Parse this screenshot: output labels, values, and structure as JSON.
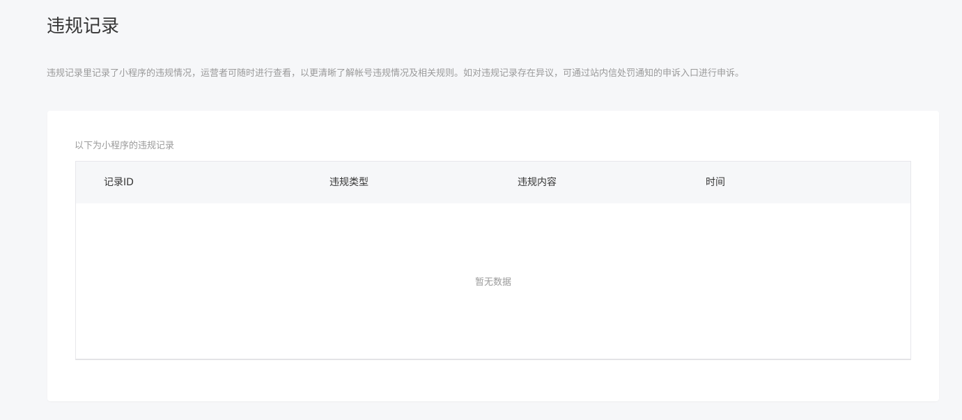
{
  "page": {
    "title": "违规记录",
    "description": "违规记录里记录了小程序的违规情况，运营者可随时进行查看，以更清晰了解帐号违规情况及相关规则。如对违规记录存在异议，可通过站内信处罚通知的申诉入口进行申诉。"
  },
  "records": {
    "subtitle": "以下为小程序的违规记录",
    "columns": [
      "记录ID",
      "违规类型",
      "违规内容",
      "时间"
    ],
    "rows": [],
    "empty_text": "暂无数据"
  },
  "colors": {
    "background": "#f6f7f9",
    "card": "#ffffff",
    "title_text": "#353535",
    "muted_text": "#9a9a9a",
    "table_header_bg": "#f6f7f9",
    "table_border": "#e7e7eb"
  }
}
